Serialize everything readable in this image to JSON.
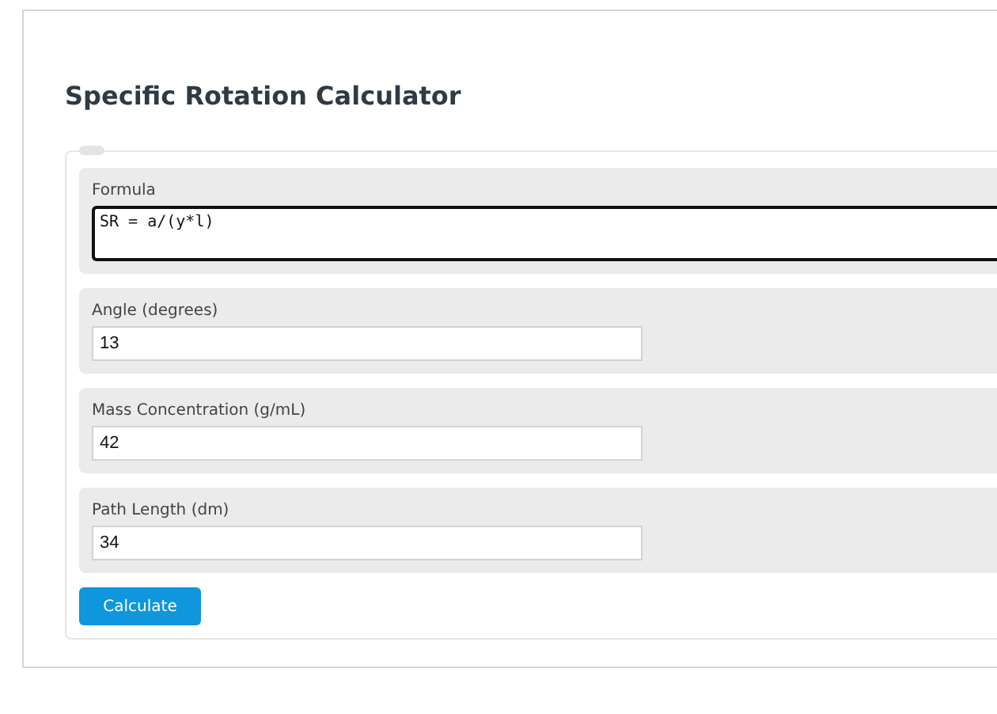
{
  "title": "Specific Rotation Calculator",
  "formula": {
    "label": "Formula",
    "value": "SR = a/(y*l)"
  },
  "fields": [
    {
      "label": "Angle (degrees)",
      "value": "13"
    },
    {
      "label": "Mass Concentration (g/mL)",
      "value": "42"
    },
    {
      "label": "Path Length (dm)",
      "value": "34"
    }
  ],
  "button": "Calculate"
}
